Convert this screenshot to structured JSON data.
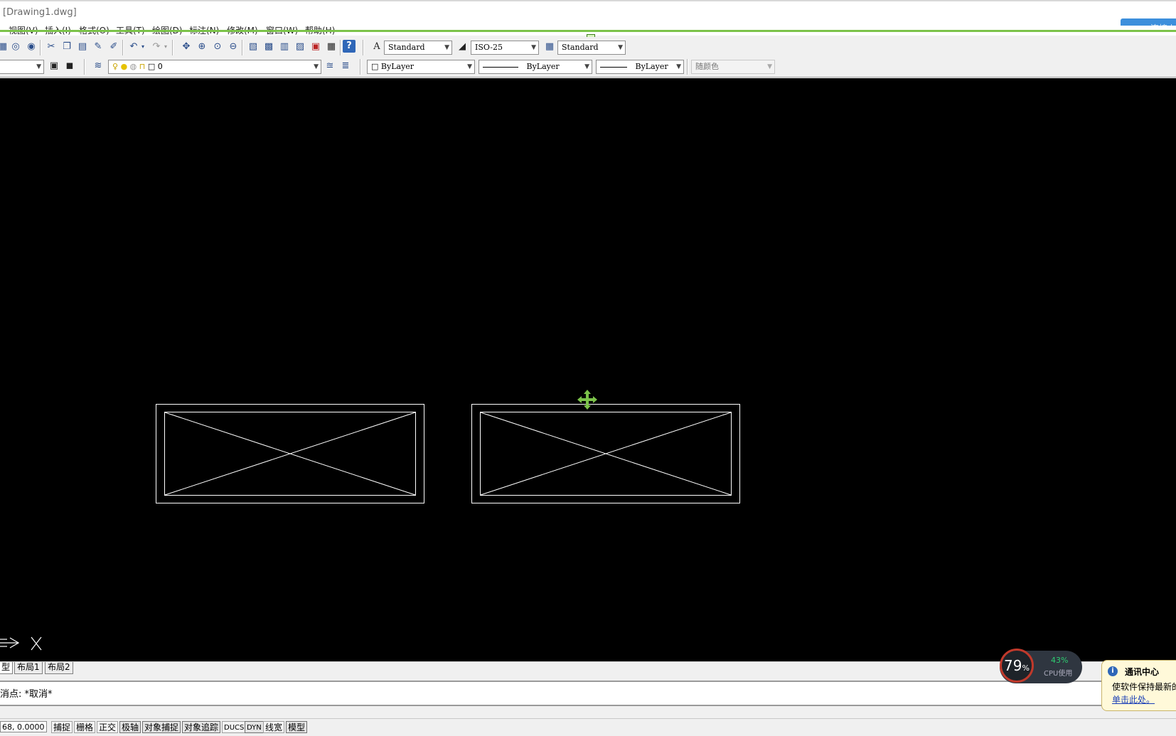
{
  "window": {
    "title": "[Drawing1.dwg]"
  },
  "sync_badge": {
    "icon": "cloud-sync-icon",
    "label": "连接上"
  },
  "menu": [
    "视图(V)",
    "插入(I)",
    "格式(O)",
    "工具(T)",
    "绘图(D)",
    "标注(N)",
    "修改(M)",
    "窗口(W)",
    "帮助(H)"
  ],
  "toolbar1": {
    "text_style": "Standard",
    "dim_style": "ISO-25",
    "table_style": "Standard"
  },
  "toolbar2": {
    "layer_name": "0",
    "color": "ByLayer",
    "linetype": "ByLayer",
    "lineweight": "ByLayer",
    "plot_style": "随颜色"
  },
  "layout_tabs": [
    "型",
    "布局1",
    "布局2"
  ],
  "command_line": "消点: *取消*",
  "statusbar": {
    "coords": "68, 0.0000",
    "buttons": [
      "捕捉",
      "栅格",
      "正交",
      "极轴",
      "对象捕捉",
      "对象追踪",
      "DUCS",
      "DYN",
      "线宽",
      "模型"
    ]
  },
  "cpu_widget": {
    "percent": "79",
    "percent_unit": "%",
    "cpu_value": "43%",
    "cpu_label": "CPU使用"
  },
  "notification": {
    "title": "通讯中心",
    "body": "使软件保持最新的",
    "link": "单击此处。"
  },
  "colors": {
    "canvas": "#000000",
    "drawing_lines": "#ffffff",
    "grip_green": "#7cc34a",
    "accent": "#3d8fdc"
  }
}
